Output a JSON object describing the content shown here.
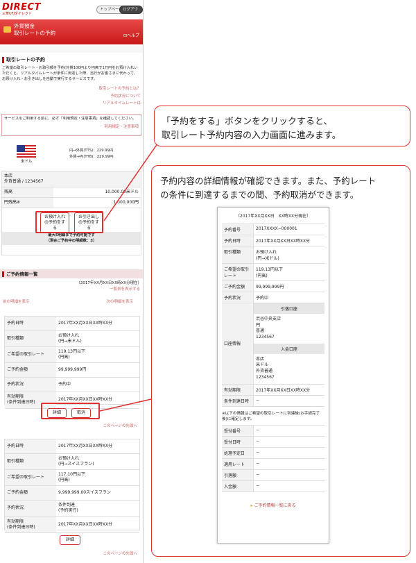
{
  "header": {
    "logo": "DIRECT",
    "logo_sub": "三菱UFJダイレクト",
    "top_button": "トップページ",
    "logout_button": "ログアウト"
  },
  "banner": {
    "line1": "外貨預金",
    "line2": "取引レートの予約",
    "help": "ヘルプ"
  },
  "intro": {
    "title": "取引レートの予約",
    "text": "ご希望の取引レート・お取引額を予約(外貨100円より円高で1万円をお預け入れいただくと、リアルタイムレートが条件に到達した際、当行がお客さまに代わって、お預け入れ・お引き出しを自動で実行するサービスです。",
    "links": [
      "取引レートの予約とは？",
      "予約状況について",
      "リアルタイムレートは"
    ]
  },
  "notice": {
    "text": "サービスをご利用する前に、必ず「利用規定・注意事項」を確認してください。",
    "link": "利用規定・注意事項"
  },
  "currency": {
    "name": "米ドル",
    "rate1": "円→外貨(TTS)：229.99円",
    "rate2": "外貨→円(TTB)：229.99円"
  },
  "account": {
    "branch": "本店",
    "type": "外貨普通 / 1234567",
    "balance_label": "残高",
    "balance_value": "10,000.00米ドル",
    "yen_label": "円残高※",
    "yen_value": "1,000,000円",
    "btn_deposit": "お預け入れの予約をする",
    "btn_withdraw": "お引き出しの予約をする",
    "note1": "最大5明細まで予約可能です",
    "note2": "（現在ご予約中の明細数：3）"
  },
  "list": {
    "title": "ご予約情報一覧",
    "datetime": "（2017年XX月XX日XX時XX分現在）",
    "show_all": "一覧表を表示する",
    "prev": "前の明細を表示",
    "next": "次の明細を表示",
    "page_top": "このページの先頭へ"
  },
  "card1": {
    "rows": [
      {
        "k": "予約日時",
        "v": "2017年XX月XX日XX時XX分"
      },
      {
        "k": "取引種類",
        "v": "お預け入れ\n(円→米ドル)"
      },
      {
        "k": "ご希望の取引レート",
        "v": "119.13円以下\n(円高)"
      },
      {
        "k": "ご予約金額",
        "v": "99,999,999円"
      },
      {
        "k": "予約状況",
        "v": "予約中"
      },
      {
        "k": "有効期限\n(条件到達日時)",
        "v": "2017年XX月XX日XX時XX分"
      }
    ],
    "btn_detail": "詳細",
    "btn_cancel": "取消"
  },
  "card2": {
    "rows": [
      {
        "k": "予約日時",
        "v": "2017年XX月XX日XX時XX分"
      },
      {
        "k": "取引種類",
        "v": "お預け入れ\n(円→スイスフラン)"
      },
      {
        "k": "ご希望の取引レート",
        "v": "117.10円以下\n(円高)"
      },
      {
        "k": "ご予約金額",
        "v": "9,999,999.00スイスフラン"
      },
      {
        "k": "予約状況",
        "v": "条件到達\n(予約実行)"
      },
      {
        "k": "有効期限\n(条件到達日時)",
        "v": "2017年XX月XX日XX時XX分"
      }
    ],
    "btn_detail": "詳細"
  },
  "callout1": {
    "line1": "「予約をする」ボタンをクリックすると、",
    "line2": "取引レート予約内容の入力画面に進みます。"
  },
  "callout2": {
    "line1": "予約内容の詳細情報が確認できます。また、予約レート",
    "line2": "の条件に到達するまでの間、予約取消ができます。"
  },
  "detail": {
    "datetime": "（2017年XX月XX日　XX時XX分現在）",
    "rows": [
      {
        "k": "予約番号",
        "v": "2017XXXX−000001"
      },
      {
        "k": "予約日時",
        "v": "2017年XX月XX日XX時XX分"
      },
      {
        "k": "取引種類",
        "v": "お預け入れ\n(円→米ドル)"
      },
      {
        "k": "ご希望の取引レート",
        "v": "119.13円以下\n(円高)"
      },
      {
        "k": "ご予約金額",
        "v": "99,999,999円"
      },
      {
        "k": "予約状況",
        "v": "予約中"
      }
    ],
    "account_label": "口座情報",
    "out_header": "引落口座",
    "out_info": "渋谷中央支店\n円\n普通\n1234567",
    "in_header": "入金口座",
    "in_info": "本店\n米ドル\n外貨普通\n1234567",
    "rows2": [
      {
        "k": "有効期限",
        "v": "2017年XX月XX日XX時XX分"
      },
      {
        "k": "条件到達日時",
        "v": "−"
      }
    ],
    "note": "※以下の情報はご希望の取引レートに到達後(お手続完了後)に確定します。",
    "rows3": [
      {
        "k": "受付番号",
        "v": "−"
      },
      {
        "k": "受付日時",
        "v": "−"
      },
      {
        "k": "処理予定日",
        "v": "−"
      },
      {
        "k": "適用レート",
        "v": "−"
      },
      {
        "k": "引落額",
        "v": "−"
      },
      {
        "k": "入金額",
        "v": "−"
      }
    ],
    "back": "ご予約情報一覧に戻る"
  }
}
